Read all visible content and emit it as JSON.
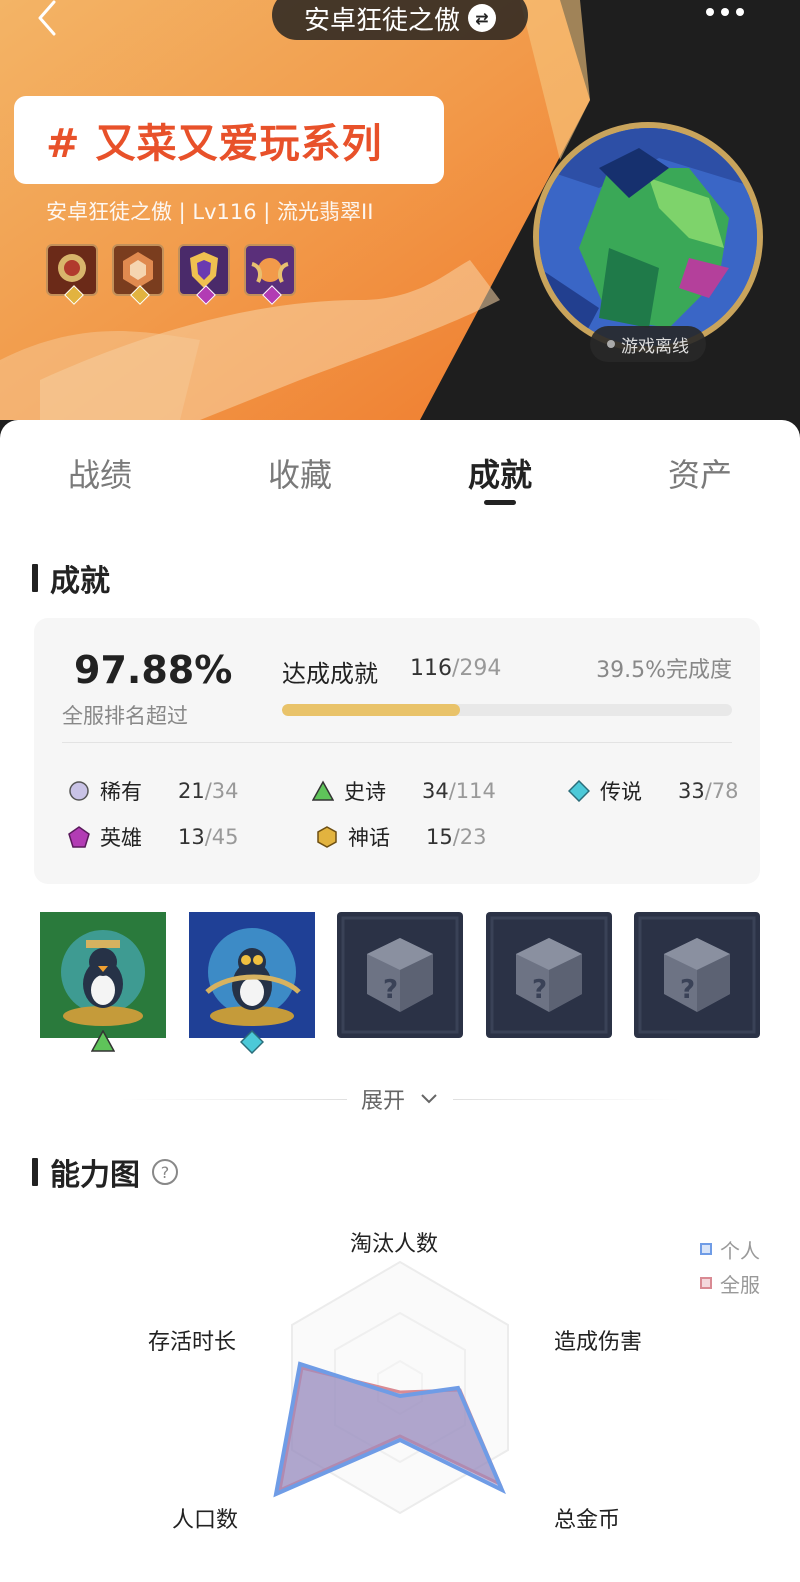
{
  "header": {
    "title": "安卓狂徒之傲",
    "tag": "# 又菜又爱玩系列",
    "profile_line": "安卓狂徒之傲 | Lv116 | 流光翡翠II",
    "status": "游戏离线"
  },
  "tabs": [
    {
      "label": "战绩"
    },
    {
      "label": "收藏"
    },
    {
      "label": "成就"
    },
    {
      "label": "资产"
    }
  ],
  "achievements": {
    "section_title": "成就",
    "rank_pct": "97.88%",
    "rank_label": "全服排名超过",
    "reached_label": "达成成就",
    "reached": "116",
    "reached_total": "/294",
    "completion": "39.5%完成度",
    "progress_fraction": 0.395,
    "rarities": [
      {
        "name": "稀有",
        "got": "21",
        "total": "/34",
        "color": "#c9c3e6",
        "icon": "circle-icon"
      },
      {
        "name": "史诗",
        "got": "34",
        "total": "/114",
        "color": "#5fc45a",
        "icon": "triangle-icon"
      },
      {
        "name": "传说",
        "got": "33",
        "total": "/78",
        "color": "#4cc9d8",
        "icon": "diamond-icon"
      },
      {
        "name": "英雄",
        "got": "13",
        "total": "/45",
        "color": "#b23cb4",
        "icon": "pentagon-icon"
      },
      {
        "name": "神话",
        "got": "15",
        "total": "/23",
        "color": "#e2b33f",
        "icon": "hexagon-icon"
      }
    ],
    "expand_label": "展开"
  },
  "ability": {
    "section_title": "能力图",
    "axes": [
      "淘汰人数",
      "造成伤害",
      "总金币",
      "人口数",
      "存活时长"
    ],
    "legend": [
      {
        "name": "个人",
        "color": "#6f9ce6"
      },
      {
        "name": "全服",
        "color": "#d98a93"
      }
    ]
  }
}
